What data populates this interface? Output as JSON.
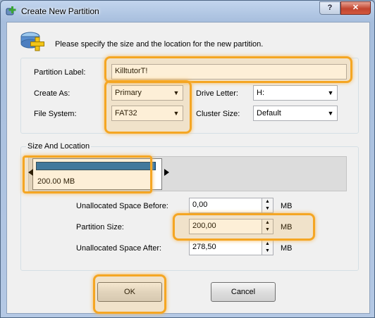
{
  "window": {
    "title": "Create New Partition"
  },
  "header": {
    "intro": "Please specify the size and the location for the new partition."
  },
  "form": {
    "partition_label_label": "Partition Label:",
    "partition_label_value": "KilltutorT!",
    "create_as_label": "Create As:",
    "create_as_value": "Primary",
    "drive_letter_label": "Drive Letter:",
    "drive_letter_value": "H:",
    "file_system_label": "File System:",
    "file_system_value": "FAT32",
    "cluster_size_label": "Cluster Size:",
    "cluster_size_value": "Default"
  },
  "size_location": {
    "group_title": "Size And Location",
    "partition_size_display": "200.00 MB",
    "unallocated_before_label": "Unallocated Space Before:",
    "unallocated_before_value": "0,00",
    "partition_size_label": "Partition Size:",
    "partition_size_value": "200,00",
    "unallocated_after_label": "Unallocated Space After:",
    "unallocated_after_value": "278,50",
    "unit": "MB"
  },
  "buttons": {
    "ok": "OK",
    "cancel": "Cancel"
  },
  "icons": {
    "title_icon": "partition-add-icon",
    "header_icon": "disk-add-icon"
  },
  "colors": {
    "highlight": "#f5a623",
    "partition_bar": "#1a70b8"
  }
}
